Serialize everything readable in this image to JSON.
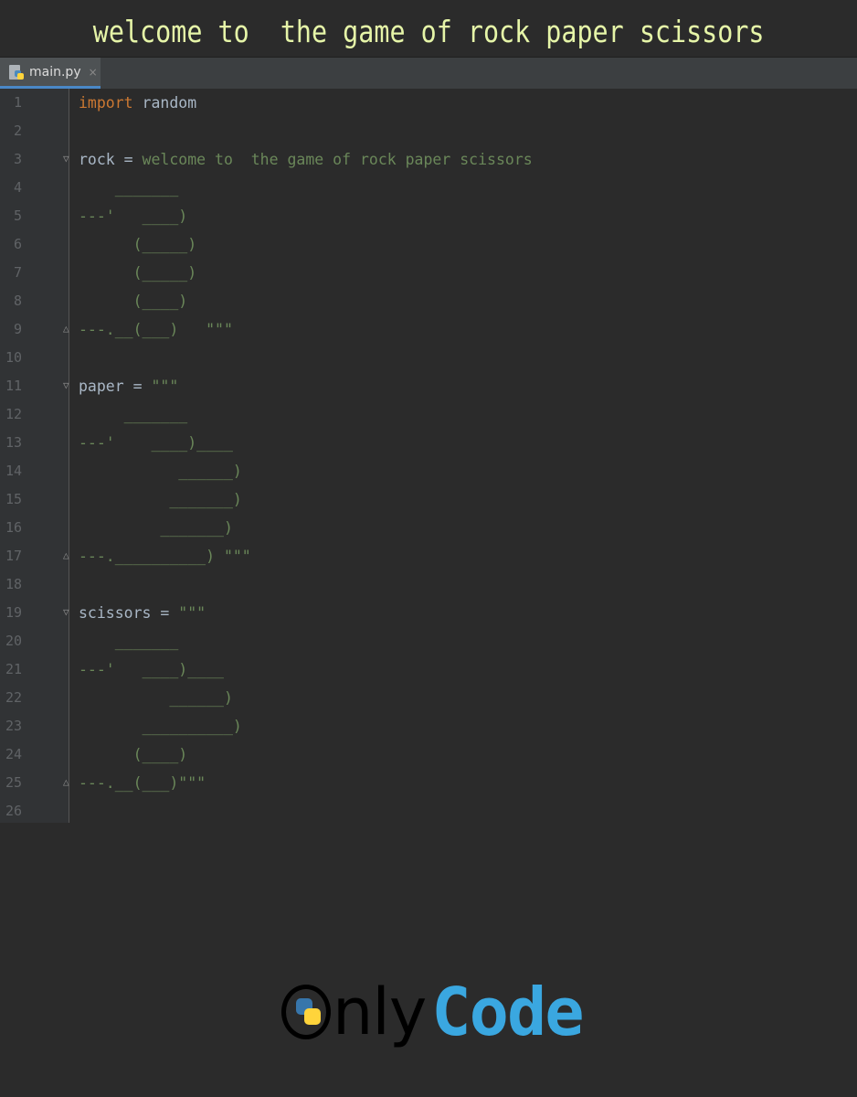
{
  "banner": {
    "title": "welcome to  the game of rock paper scissors"
  },
  "tab": {
    "filename": "main.py",
    "icon": "python-file-icon",
    "close_glyph": "×"
  },
  "editor": {
    "lines": [
      {
        "num": "1",
        "fold": "",
        "tokens": [
          {
            "t": "kw",
            "v": "import"
          },
          {
            "t": "id",
            "v": " random"
          }
        ]
      },
      {
        "num": "2",
        "fold": "",
        "tokens": []
      },
      {
        "num": "3",
        "fold": "open",
        "tokens": [
          {
            "t": "id",
            "v": "rock = "
          },
          {
            "t": "str",
            "v": "welcome to  the game of rock paper scissors"
          }
        ]
      },
      {
        "num": "4",
        "fold": "",
        "tokens": [
          {
            "t": "str",
            "v": "    _______"
          }
        ]
      },
      {
        "num": "5",
        "fold": "",
        "tokens": [
          {
            "t": "str",
            "v": "---'   ____)"
          }
        ]
      },
      {
        "num": "6",
        "fold": "",
        "tokens": [
          {
            "t": "str",
            "v": "      (_____)"
          }
        ]
      },
      {
        "num": "7",
        "fold": "",
        "tokens": [
          {
            "t": "str",
            "v": "      (_____)"
          }
        ]
      },
      {
        "num": "8",
        "fold": "",
        "tokens": [
          {
            "t": "str",
            "v": "      (____)"
          }
        ]
      },
      {
        "num": "9",
        "fold": "close",
        "tokens": [
          {
            "t": "str",
            "v": "---.__(___)   \"\"\""
          }
        ]
      },
      {
        "num": "10",
        "fold": "",
        "tokens": []
      },
      {
        "num": "11",
        "fold": "open",
        "tokens": [
          {
            "t": "id",
            "v": "paper = "
          },
          {
            "t": "str",
            "v": "\"\"\""
          }
        ]
      },
      {
        "num": "12",
        "fold": "",
        "tokens": [
          {
            "t": "str",
            "v": "     _______"
          }
        ]
      },
      {
        "num": "13",
        "fold": "",
        "tokens": [
          {
            "t": "str",
            "v": "---'    ____)____"
          }
        ]
      },
      {
        "num": "14",
        "fold": "",
        "tokens": [
          {
            "t": "str",
            "v": "           ______)"
          }
        ]
      },
      {
        "num": "15",
        "fold": "",
        "tokens": [
          {
            "t": "str",
            "v": "          _______)"
          }
        ]
      },
      {
        "num": "16",
        "fold": "",
        "tokens": [
          {
            "t": "str",
            "v": "         _______)"
          }
        ]
      },
      {
        "num": "17",
        "fold": "close",
        "tokens": [
          {
            "t": "str",
            "v": "---.__________) \"\"\""
          }
        ]
      },
      {
        "num": "18",
        "fold": "",
        "tokens": []
      },
      {
        "num": "19",
        "fold": "open",
        "tokens": [
          {
            "t": "id",
            "v": "scissors = "
          },
          {
            "t": "str",
            "v": "\"\"\""
          }
        ]
      },
      {
        "num": "20",
        "fold": "",
        "tokens": [
          {
            "t": "str",
            "v": "    _______"
          }
        ]
      },
      {
        "num": "21",
        "fold": "",
        "tokens": [
          {
            "t": "str",
            "v": "---'   ____)____"
          }
        ]
      },
      {
        "num": "22",
        "fold": "",
        "tokens": [
          {
            "t": "str",
            "v": "          ______)"
          }
        ]
      },
      {
        "num": "23",
        "fold": "",
        "tokens": [
          {
            "t": "str",
            "v": "       __________)"
          }
        ]
      },
      {
        "num": "24",
        "fold": "",
        "tokens": [
          {
            "t": "str",
            "v": "      (____)"
          }
        ]
      },
      {
        "num": "25",
        "fold": "close",
        "tokens": [
          {
            "t": "str",
            "v": "---.__(___)\"\"\""
          }
        ]
      },
      {
        "num": "26",
        "fold": "",
        "tokens": []
      }
    ]
  },
  "logo": {
    "part1": "nly",
    "part2": "Code",
    "icon": "python-logo-icon"
  },
  "colors": {
    "keyword": "#cc7832",
    "string": "#6a8759",
    "identifier": "#a9b7c6",
    "banner_text": "#e6f5a8",
    "logo_code": "#3aa7e0"
  }
}
